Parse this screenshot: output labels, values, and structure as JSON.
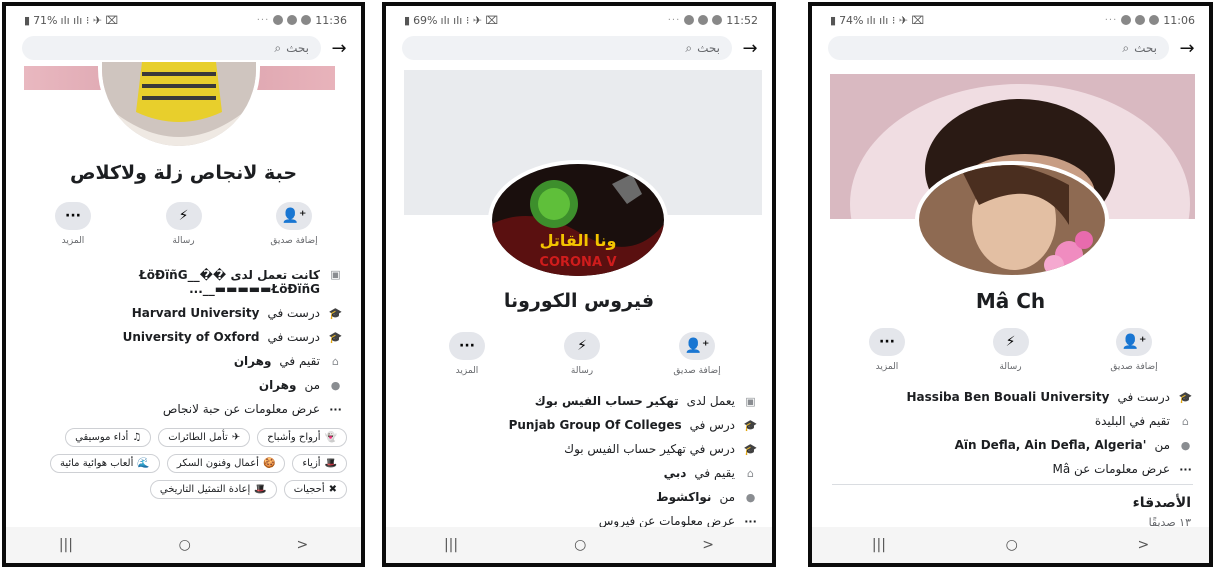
{
  "colors": {
    "accent": "#1877f2",
    "icon_gray": "#8a8d91",
    "action_bg": "#e4e6eb",
    "search_bg": "#f0f2f5"
  },
  "shared": {
    "search_placeholder": "بحث",
    "actions": {
      "add_friend": "إضافة صديق",
      "message": "رسالة",
      "more": "المزيد"
    },
    "nav": {
      "recents": "|||",
      "home": "○",
      "back": ">"
    },
    "status_dots": "···"
  },
  "phones": [
    {
      "status": {
        "battery": "71%",
        "time": "11:36"
      },
      "profile_name": "حبة لانجاص زلة ولاكلاص",
      "info": [
        {
          "icon": "briefcase-icon",
          "text": "كانت تعمل لدى ŁöĐïñG__�� ▬▬▬▬▬ŁöĐïñG__..."
        },
        {
          "icon": "graduation-cap-icon",
          "prefix": "درست في",
          "bold": "Harvard University"
        },
        {
          "icon": "graduation-cap-icon",
          "prefix": "درست في",
          "bold": "University of Oxford"
        },
        {
          "icon": "home-icon",
          "prefix": "تقيم في",
          "bold": "وهران"
        },
        {
          "icon": "location-pin-icon",
          "prefix": "من",
          "bold": "وهران"
        },
        {
          "icon": "more-dots-icon",
          "text": "عرض معلومات عن حبة لانجاص"
        }
      ],
      "chips": [
        "أرواح وأشباح",
        "تأمل الطائرات",
        "أداء موسيقي",
        "أزياء",
        "أعمال وفنون السكر",
        "ألعاب هوائية مائية",
        "أحجيات",
        "إعادة التمثيل التاريخي"
      ]
    },
    {
      "status": {
        "battery": "69%",
        "time": "11:52"
      },
      "profile_name": "فيروس الكورونا",
      "avatar_text": "ونا القاتل",
      "avatar_subtext": "CORONA V",
      "info": [
        {
          "icon": "briefcase-icon",
          "prefix": "يعمل لدى",
          "bold": "تهكير حساب الفيس بوك"
        },
        {
          "icon": "graduation-cap-icon",
          "prefix": "درس في",
          "bold": "Punjab Group Of Colleges"
        },
        {
          "icon": "graduation-cap-icon",
          "text": "درس في تهكير حساب الفيس بوك"
        },
        {
          "icon": "home-icon",
          "prefix": "يقيم في",
          "bold": "دبي"
        },
        {
          "icon": "location-pin-icon",
          "prefix": "من",
          "bold": "نواكشوط"
        },
        {
          "icon": "more-dots-icon",
          "text": "عرض معلومات عن فيروس"
        }
      ]
    },
    {
      "status": {
        "battery": "74%",
        "time": "11:06"
      },
      "profile_name": "Mâ Ch",
      "info": [
        {
          "icon": "graduation-cap-icon",
          "prefix": "درست في",
          "bold": "Hassiba Ben Bouali University"
        },
        {
          "icon": "home-icon",
          "text": "تقيم في البليدة"
        },
        {
          "icon": "location-pin-icon",
          "prefix": "من",
          "bold": "'Aïn Defla, Ain Defla, Algeria"
        },
        {
          "icon": "more-dots-icon",
          "text": "عرض معلومات عن Mâ"
        }
      ],
      "friends_title": "الأصدقاء",
      "friends_count": "١٣ صديقًا"
    }
  ]
}
